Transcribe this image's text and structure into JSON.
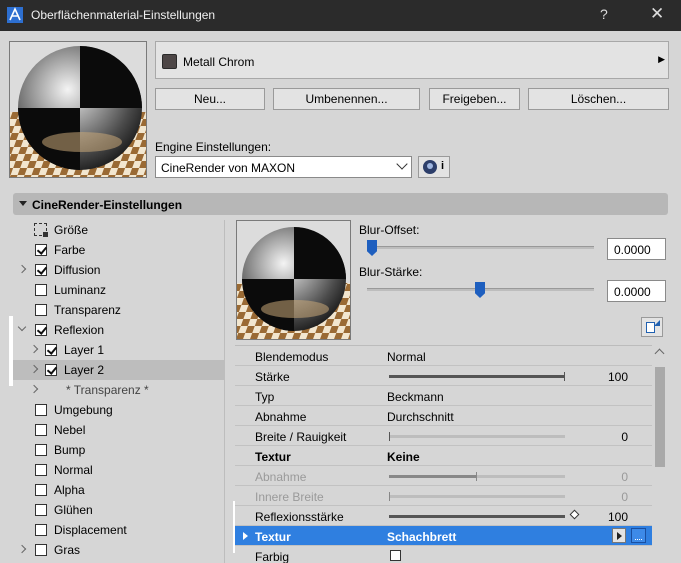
{
  "window": {
    "title": "Oberflächenmaterial-Einstellungen",
    "help": "?",
    "close": "✕"
  },
  "material": {
    "name": "Metall Chrom",
    "swatch_color": "#4d4646"
  },
  "buttons": {
    "new": "Neu...",
    "rename": "Umbenennen...",
    "share": "Freigeben...",
    "delete": "Löschen..."
  },
  "engine": {
    "label": "Engine Einstellungen:",
    "selected": "CineRender von MAXON",
    "info": "i"
  },
  "section": {
    "title": "CineRender-Einstellungen"
  },
  "tree": [
    {
      "label": "Größe",
      "icon": "size-icon"
    },
    {
      "label": "Farbe",
      "checked": true
    },
    {
      "label": "Diffusion",
      "checked": true,
      "expander": "collapsed"
    },
    {
      "label": "Luminanz",
      "checked": false
    },
    {
      "label": "Transparenz",
      "checked": false
    },
    {
      "label": "Reflexion",
      "checked": true,
      "expander": "expanded"
    },
    {
      "label": "Layer 1",
      "checked": true,
      "expander": "collapsed"
    },
    {
      "label": "Layer 2",
      "checked": true,
      "expander": "collapsed",
      "selected": true
    },
    {
      "label": "* Transparenz *"
    },
    {
      "label": "Umgebung",
      "checked": false
    },
    {
      "label": "Nebel",
      "checked": false
    },
    {
      "label": "Bump",
      "checked": false
    },
    {
      "label": "Normal",
      "checked": false
    },
    {
      "label": "Alpha",
      "checked": false
    },
    {
      "label": "Glühen",
      "checked": false
    },
    {
      "label": "Displacement",
      "checked": false
    },
    {
      "label": "Gras",
      "checked": false,
      "expander": "collapsed"
    }
  ],
  "blur": {
    "offset_label": "Blur-Offset:",
    "offset_value": "0.0000",
    "offset_level": 0,
    "strength_label": "Blur-Stärke:",
    "strength_value": "0.0000",
    "strength_level": 0.5
  },
  "properties": [
    {
      "key": "Blendemodus",
      "value": "Normal"
    },
    {
      "key": "Stärke",
      "slider": 1.0,
      "number": "100"
    },
    {
      "key": "Typ",
      "value": "Beckmann"
    },
    {
      "key": "Abnahme",
      "value": "Durchschnitt"
    },
    {
      "key": "Breite / Rauigkeit",
      "slider": 0,
      "number": "0"
    },
    {
      "key": "Textur",
      "value": "Keine",
      "bold": true
    },
    {
      "key": "Abnahme",
      "slider": 0.5,
      "number": "0",
      "dim": true
    },
    {
      "key": "Innere Breite",
      "slider": 0,
      "number": "0",
      "dim": true
    },
    {
      "key": "Reflexionsstärke",
      "slider": 1.0,
      "number": "100"
    },
    {
      "key": "Textur",
      "value": "Schachbrett",
      "selected": true
    },
    {
      "key": "Farbig",
      "checkbox": false
    }
  ],
  "colors": {
    "accent": "#2f7fe0",
    "slider_thumb": "#1e5fbf",
    "titlebar": "#2b2b2b"
  }
}
